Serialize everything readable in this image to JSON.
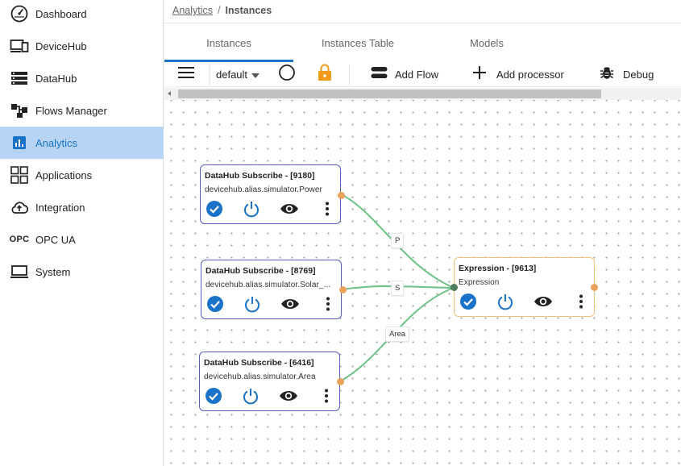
{
  "sidebar": {
    "items": [
      {
        "label": "Dashboard",
        "icon": "dashboard-gauge-icon"
      },
      {
        "label": "DeviceHub",
        "icon": "devices-icon"
      },
      {
        "label": "DataHub",
        "icon": "storage-icon"
      },
      {
        "label": "Flows Manager",
        "icon": "flow-icon"
      },
      {
        "label": "Analytics",
        "icon": "analytics-chart-icon",
        "active": true
      },
      {
        "label": "Applications",
        "icon": "apps-grid-icon"
      },
      {
        "label": "Integration",
        "icon": "cloud-upload-icon"
      },
      {
        "label": "OPC UA",
        "icon": "opc-text-icon",
        "icon_text": "OPC"
      },
      {
        "label": "System",
        "icon": "laptop-icon"
      }
    ]
  },
  "breadcrumb": {
    "link": "Analytics",
    "separator": "/",
    "current": "Instances"
  },
  "tabs": [
    {
      "label": "Instances",
      "active": true
    },
    {
      "label": "Instances Table"
    },
    {
      "label": "Models"
    }
  ],
  "toolbar": {
    "flow_selector": "default",
    "add_flow": "Add Flow",
    "add_processor": "Add processor",
    "debug": "Debug"
  },
  "flow": {
    "nodes": [
      {
        "title": "DataHub Subscribe - [9180]",
        "subtitle": "devicehub.alias.simulator.Power"
      },
      {
        "title": "DataHub Subscribe - [8769]",
        "subtitle": "devicehub.alias.simulator.Solar_..."
      },
      {
        "title": "DataHub Subscribe - [6416]",
        "subtitle": "devicehub.alias.simulator.Area"
      },
      {
        "title": "Expression - [9613]",
        "subtitle": "Expression"
      }
    ],
    "wire_labels": [
      "P",
      "S",
      "Area"
    ]
  },
  "colors": {
    "accent": "#1a73c8",
    "active_nav_bg": "#b7d4f5",
    "node_border": "#5a5fbf",
    "expression_border": "#f0c27a",
    "wire": "#6cc287",
    "output_port": "#e9a35c",
    "lock": "#f09a1a"
  }
}
